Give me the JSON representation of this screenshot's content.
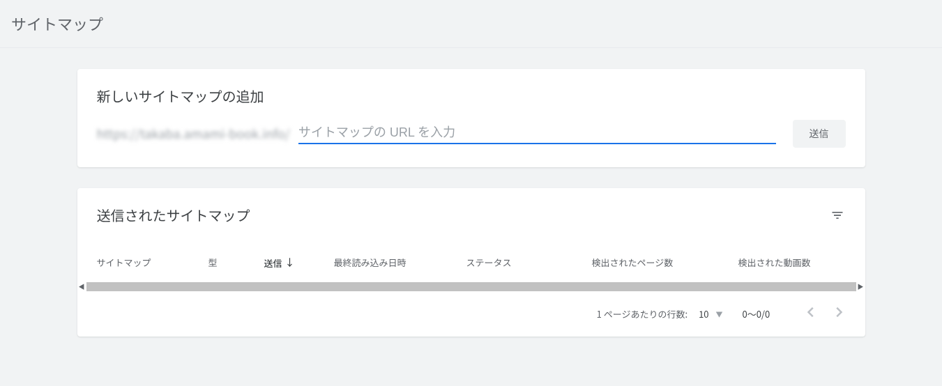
{
  "page": {
    "title": "サイトマップ"
  },
  "add_card": {
    "title": "新しいサイトマップの追加",
    "url_prefix": "https://takaba.amami-book.info/",
    "input_placeholder": "サイトマップの URL を入力",
    "input_value": "",
    "submit_label": "送信"
  },
  "list_card": {
    "title": "送信されたサイトマップ",
    "columns": {
      "sitemap": "サイトマップ",
      "type": "型",
      "submitted": "送信",
      "last_read": "最終読み込み日時",
      "status": "ステータス",
      "pages": "検出されたページ数",
      "videos": "検出された動画数"
    },
    "pagination": {
      "rows_label": "1 ページあたりの行数:",
      "rows_value": "10",
      "range": "0～0/0"
    }
  }
}
